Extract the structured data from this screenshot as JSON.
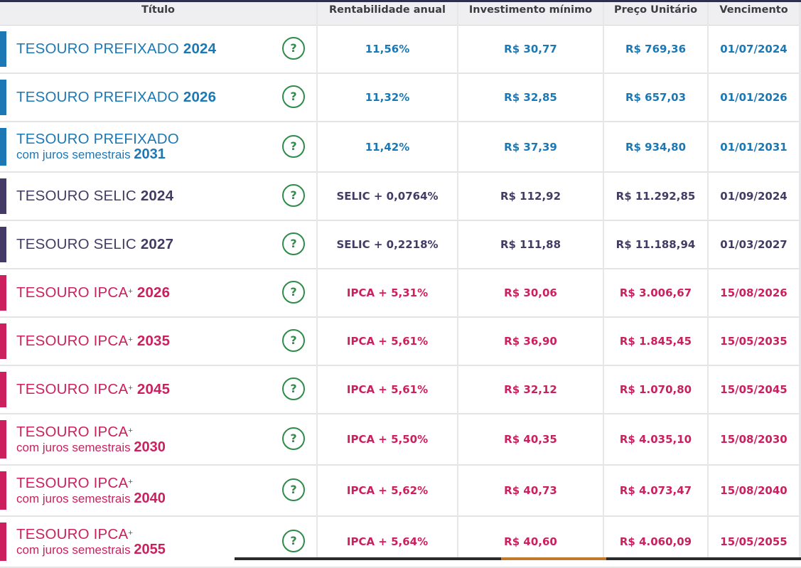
{
  "headers": {
    "titulo": "Título",
    "rentabilidade": "Rentabilidade anual",
    "investimento": "Investimento mínimo",
    "preco": "Preço Unitário",
    "vencimento": "Vencimento"
  },
  "help_icon_symbol": "?",
  "help_icon_name": "question-circle-icon",
  "colors": {
    "prefixado": "#1b78b4",
    "selic": "#433b64",
    "ipca": "#cc1f5e",
    "help": "#2f8b4a"
  },
  "rows": [
    {
      "type": "prefixado",
      "name_main": "TESOURO PREFIXADO",
      "name_sub": "",
      "year": "2024",
      "plus": "",
      "rentabilidade": "11,56%",
      "investimento": "R$ 30,77",
      "preco": "R$ 769,36",
      "vencimento": "01/07/2024"
    },
    {
      "type": "prefixado",
      "name_main": "TESOURO PREFIXADO",
      "name_sub": "",
      "year": "2026",
      "plus": "",
      "rentabilidade": "11,32%",
      "investimento": "R$ 32,85",
      "preco": "R$ 657,03",
      "vencimento": "01/01/2026"
    },
    {
      "type": "prefixado",
      "name_main": "TESOURO PREFIXADO",
      "name_sub": "com juros semestrais",
      "year": "2031",
      "plus": "",
      "rentabilidade": "11,42%",
      "investimento": "R$ 37,39",
      "preco": "R$ 934,80",
      "vencimento": "01/01/2031"
    },
    {
      "type": "selic",
      "name_main": "TESOURO SELIC",
      "name_sub": "",
      "year": "2024",
      "plus": "",
      "rentabilidade": "SELIC + 0,0764%",
      "investimento": "R$ 112,92",
      "preco": "R$ 11.292,85",
      "vencimento": "01/09/2024"
    },
    {
      "type": "selic",
      "name_main": "TESOURO SELIC",
      "name_sub": "",
      "year": "2027",
      "plus": "",
      "rentabilidade": "SELIC + 0,2218%",
      "investimento": "R$ 111,88",
      "preco": "R$ 11.188,94",
      "vencimento": "01/03/2027"
    },
    {
      "type": "ipca",
      "name_main": "TESOURO IPCA",
      "name_sub": "",
      "year": "2026",
      "plus": "+",
      "rentabilidade": "IPCA + 5,31%",
      "investimento": "R$ 30,06",
      "preco": "R$ 3.006,67",
      "vencimento": "15/08/2026"
    },
    {
      "type": "ipca",
      "name_main": "TESOURO IPCA",
      "name_sub": "",
      "year": "2035",
      "plus": "+",
      "rentabilidade": "IPCA + 5,61%",
      "investimento": "R$ 36,90",
      "preco": "R$ 1.845,45",
      "vencimento": "15/05/2035"
    },
    {
      "type": "ipca",
      "name_main": "TESOURO IPCA",
      "name_sub": "",
      "year": "2045",
      "plus": "+",
      "rentabilidade": "IPCA + 5,61%",
      "investimento": "R$ 32,12",
      "preco": "R$ 1.070,80",
      "vencimento": "15/05/2045"
    },
    {
      "type": "ipca",
      "name_main": "TESOURO IPCA",
      "name_sub": "com juros semestrais",
      "year": "2030",
      "plus": "+",
      "rentabilidade": "IPCA + 5,50%",
      "investimento": "R$ 40,35",
      "preco": "R$ 4.035,10",
      "vencimento": "15/08/2030"
    },
    {
      "type": "ipca",
      "name_main": "TESOURO IPCA",
      "name_sub": "com juros semestrais",
      "year": "2040",
      "plus": "+",
      "rentabilidade": "IPCA + 5,62%",
      "investimento": "R$ 40,73",
      "preco": "R$ 4.073,47",
      "vencimento": "15/08/2040"
    },
    {
      "type": "ipca",
      "name_main": "TESOURO IPCA",
      "name_sub": "com juros semestrais",
      "year": "2055",
      "plus": "+",
      "rentabilidade": "IPCA + 5,64%",
      "investimento": "R$ 40,60",
      "preco": "R$ 4.060,09",
      "vencimento": "15/05/2055"
    }
  ]
}
